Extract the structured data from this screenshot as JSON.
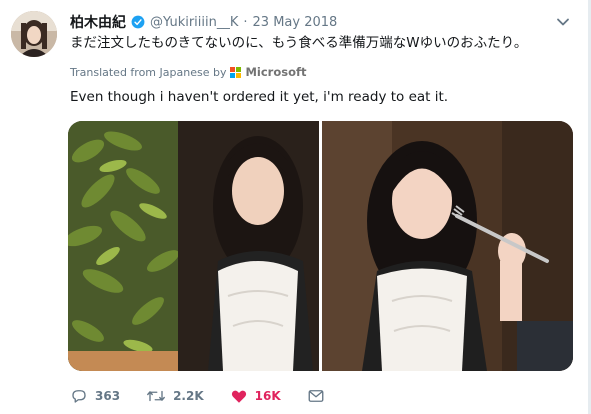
{
  "tweet": {
    "display_name": "柏木由紀",
    "handle": "@Yukiriiiin__K",
    "separator": "·",
    "date": "23 May 2018",
    "text": "まだ注文したものきてないのに、もう食べる準備万端なWゆいのおふたり。",
    "translated_from": "Translated from Japanese by",
    "translator": "Microsoft",
    "translation": "Even though i haven't ordered it yet, i'm ready to eat it."
  },
  "media": {
    "photos": [
      {
        "name": "photo-left"
      },
      {
        "name": "photo-right"
      }
    ]
  },
  "actions": {
    "reply_count": "363",
    "retweet_count": "2.2K",
    "like_count": "16K"
  },
  "colors": {
    "accent": "#1da1f2",
    "like": "#e0245e",
    "muted": "#657786",
    "text": "#14171a"
  },
  "icons": [
    "verified-badge-icon",
    "chevron-down-icon",
    "microsoft-logo-icon",
    "reply-icon",
    "retweet-icon",
    "like-icon",
    "dm-icon"
  ]
}
